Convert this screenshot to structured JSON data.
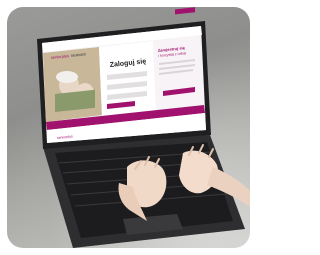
{
  "screen": {
    "brand_left": "seniorplus",
    "brand_right": "nextcare",
    "heading": "Zaloguj się",
    "register_heading": "Zarejestruj się",
    "register_subheading": "i korzystaj z usług",
    "footer_brand": "seniorplus"
  },
  "colors": {
    "accent": "#a0126e",
    "laptop_body": "#2b2b2d",
    "keyboard": "#1a1a1c"
  }
}
